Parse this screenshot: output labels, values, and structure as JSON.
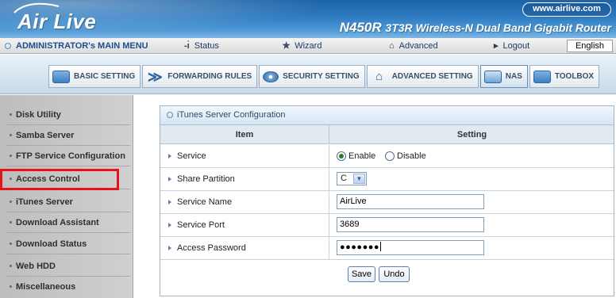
{
  "header": {
    "logo": "Air Live",
    "website": "www.airlive.com",
    "model": "N450R",
    "model_desc": "3T3R Wireless-N Dual Band Gigabit Router"
  },
  "menubar": {
    "admin": "ADMINISTRATOR's MAIN MENU",
    "status": "Status",
    "wizard": "Wizard",
    "advanced": "Advanced",
    "logout": "Logout",
    "language": "English"
  },
  "nav": {
    "items": [
      {
        "label": "BASIC SETTING",
        "icon": "folder-icon"
      },
      {
        "label": "FORWARDING RULES",
        "icon": "forward-icon"
      },
      {
        "label": "SECURITY SETTING",
        "icon": "eye-icon"
      },
      {
        "label": "ADVANCED SETTING",
        "icon": "advanced-icon"
      },
      {
        "label": "NAS",
        "icon": "nas-icon",
        "active": true
      },
      {
        "label": "TOOLBOX",
        "icon": "folder-icon"
      }
    ]
  },
  "sidebar": {
    "items": [
      {
        "label": "Disk Utility"
      },
      {
        "label": "Samba Server"
      },
      {
        "label": "FTP Service Configuration"
      },
      {
        "label": "Access Control",
        "highlighted": true
      },
      {
        "label": "iTunes Server"
      },
      {
        "label": "Download Assistant"
      },
      {
        "label": "Download Status"
      },
      {
        "label": "Web HDD"
      },
      {
        "label": "Miscellaneous"
      }
    ],
    "highlight_color": "#e4141c"
  },
  "config": {
    "title": "iTunes Server Configuration",
    "col_item": "Item",
    "col_setting": "Setting",
    "rows": {
      "service": {
        "label": "Service",
        "enable": "Enable",
        "disable": "Disable",
        "selected": "Enable"
      },
      "share_partition": {
        "label": "Share Partition",
        "value": "C"
      },
      "service_name": {
        "label": "Service Name",
        "value": "AirLive"
      },
      "service_port": {
        "label": "Service Port",
        "value": "3689"
      },
      "access_password": {
        "label": "Access Password",
        "value": "●●●●●●●"
      }
    },
    "save": "Save",
    "undo": "Undo"
  }
}
